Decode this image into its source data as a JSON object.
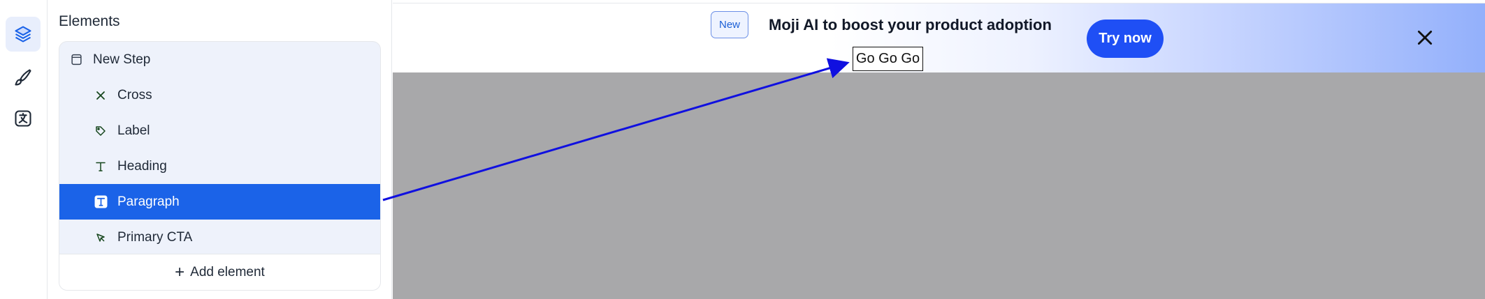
{
  "rail": {
    "items": [
      {
        "icon": "layers-icon",
        "active": true
      },
      {
        "icon": "brush-icon",
        "active": false
      },
      {
        "icon": "translate-icon",
        "active": false
      }
    ]
  },
  "panel": {
    "title": "Elements",
    "parent": {
      "label": "New Step",
      "icon": "step-icon"
    },
    "children": [
      {
        "label": "Cross",
        "icon": "cross-icon"
      },
      {
        "label": "Label",
        "icon": "tag-icon"
      },
      {
        "label": "Heading",
        "icon": "heading-icon"
      },
      {
        "label": "Paragraph",
        "icon": "paragraph-icon",
        "selected": true
      },
      {
        "label": "Primary CTA",
        "icon": "cursor-icon"
      }
    ],
    "add_label": "Add element"
  },
  "banner": {
    "badge": "New",
    "headline": "Moji AI to boost your product adoption",
    "label_text": "Go Go Go",
    "cta_label": "Try now",
    "close_icon": "close-icon"
  },
  "colors": {
    "accent": "#1b63e8",
    "cta": "#1f4ff5",
    "arrow": "#1010e0",
    "canvas": "#a8a8aa"
  }
}
